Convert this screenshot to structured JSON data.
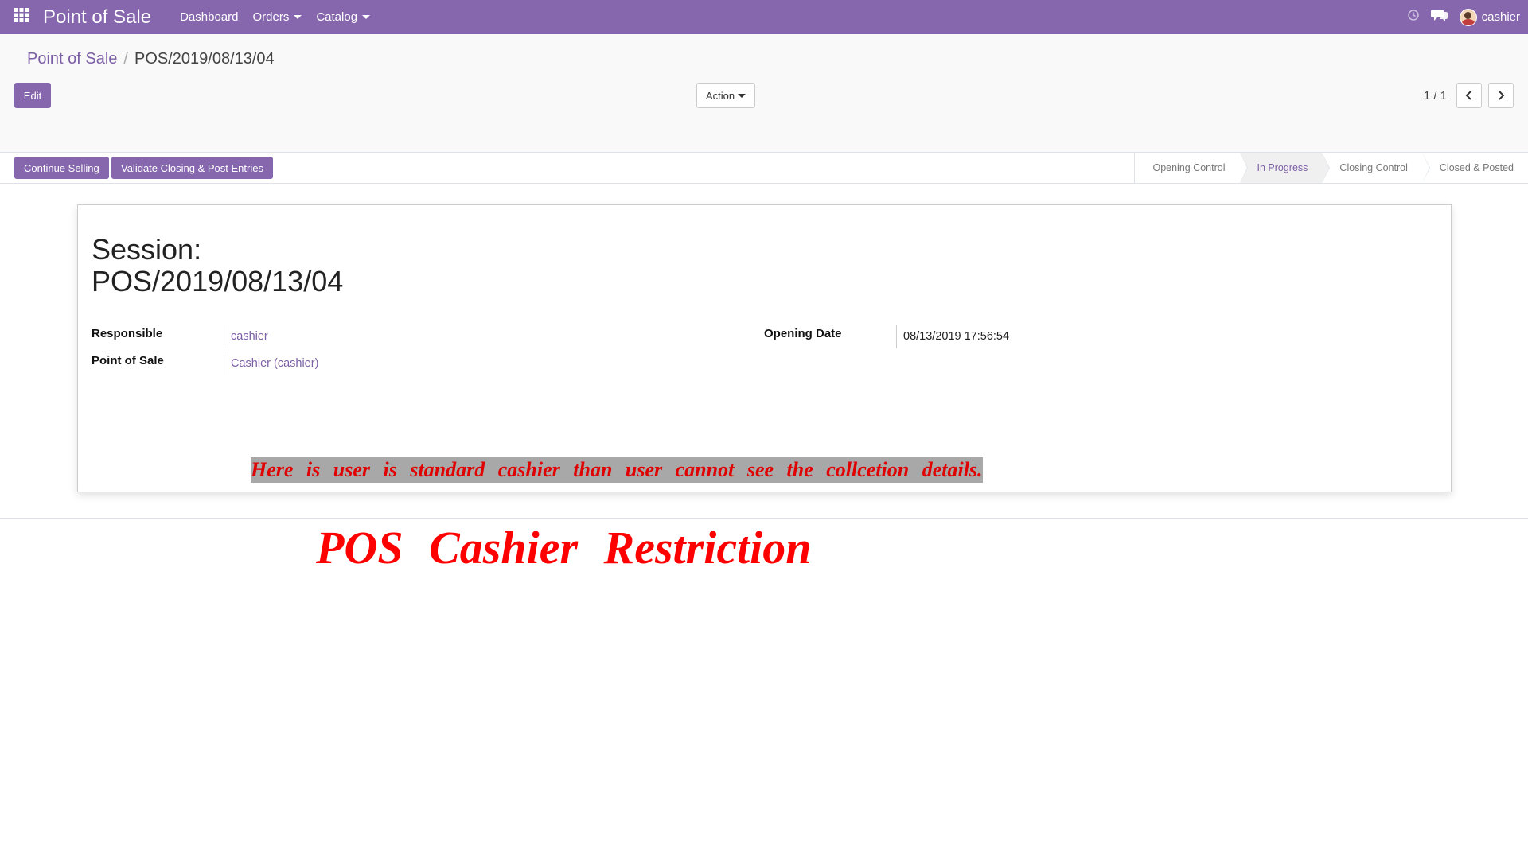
{
  "navbar": {
    "app_name": "Point of Sale",
    "menu": [
      "Dashboard",
      "Orders",
      "Catalog"
    ],
    "user_name": "cashier",
    "icons": [
      "apps-grid-icon",
      "activity-clock-icon",
      "chat-icon",
      "avatar"
    ]
  },
  "breadcrumb": {
    "parent": "Point of Sale",
    "current": "POS/2019/08/13/04"
  },
  "toolbar": {
    "edit_label": "Edit",
    "action_label": "Action",
    "pager_value": "1 / 1"
  },
  "statusbar": {
    "buttons": [
      "Continue Selling",
      "Validate Closing & Post Entries"
    ],
    "stages": [
      {
        "label": "Opening Control",
        "active": false
      },
      {
        "label": "In Progress",
        "active": true
      },
      {
        "label": "Closing Control",
        "active": false
      },
      {
        "label": "Closed & Posted",
        "active": false
      }
    ]
  },
  "form": {
    "title_prefix": "Session:",
    "title": "POS/2019/08/13/04",
    "fields": {
      "responsible_label": "Responsible",
      "responsible_value": "cashier",
      "pos_label": "Point of Sale",
      "pos_value": "Cashier (cashier)",
      "opening_date_label": "Opening Date",
      "opening_date_value": "08/13/2019 17:56:54"
    },
    "note": "Here is user is standard cashier than user cannot see the collcetion details."
  },
  "caption": "POS Cashier Restriction",
  "colors": {
    "brand": "#8667ae",
    "link": "#7c5fa6",
    "annotation_red": "#ff0000"
  }
}
